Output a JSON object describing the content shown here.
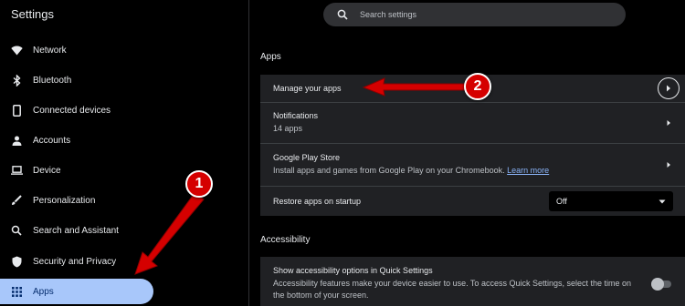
{
  "app": {
    "title": "Settings"
  },
  "search": {
    "placeholder": "Search settings"
  },
  "sidebar": {
    "items": [
      {
        "label": "Network",
        "icon": "wifi-icon"
      },
      {
        "label": "Bluetooth",
        "icon": "bluetooth-icon"
      },
      {
        "label": "Connected devices",
        "icon": "phone-icon"
      },
      {
        "label": "Accounts",
        "icon": "person-icon"
      },
      {
        "label": "Device",
        "icon": "laptop-icon"
      },
      {
        "label": "Personalization",
        "icon": "brush-icon"
      },
      {
        "label": "Search and Assistant",
        "icon": "search-icon"
      },
      {
        "label": "Security and Privacy",
        "icon": "shield-icon"
      },
      {
        "label": "Apps",
        "icon": "apps-grid-icon",
        "active": true
      }
    ]
  },
  "apps_section": {
    "title": "Apps",
    "manage": {
      "label": "Manage your apps"
    },
    "notifications": {
      "label": "Notifications",
      "sub": "14 apps"
    },
    "play_store": {
      "label": "Google Play Store",
      "sub": "Install apps and games from Google Play on your Chromebook.",
      "link": "Learn more"
    },
    "restore": {
      "label": "Restore apps on startup",
      "value": "Off"
    }
  },
  "accessibility_section": {
    "title": "Accessibility",
    "quick_settings": {
      "label": "Show accessibility options in Quick Settings",
      "sub1": "Accessibility features make your device easier to use. To access Quick Settings, select the time on",
      "sub2": "the bottom of your screen."
    }
  },
  "annotations": {
    "badge1": "1",
    "badge2": "2"
  },
  "colors": {
    "active_nav": "#a8c7fa",
    "annotation_red": "#d50000",
    "link": "#8ab4f8"
  }
}
